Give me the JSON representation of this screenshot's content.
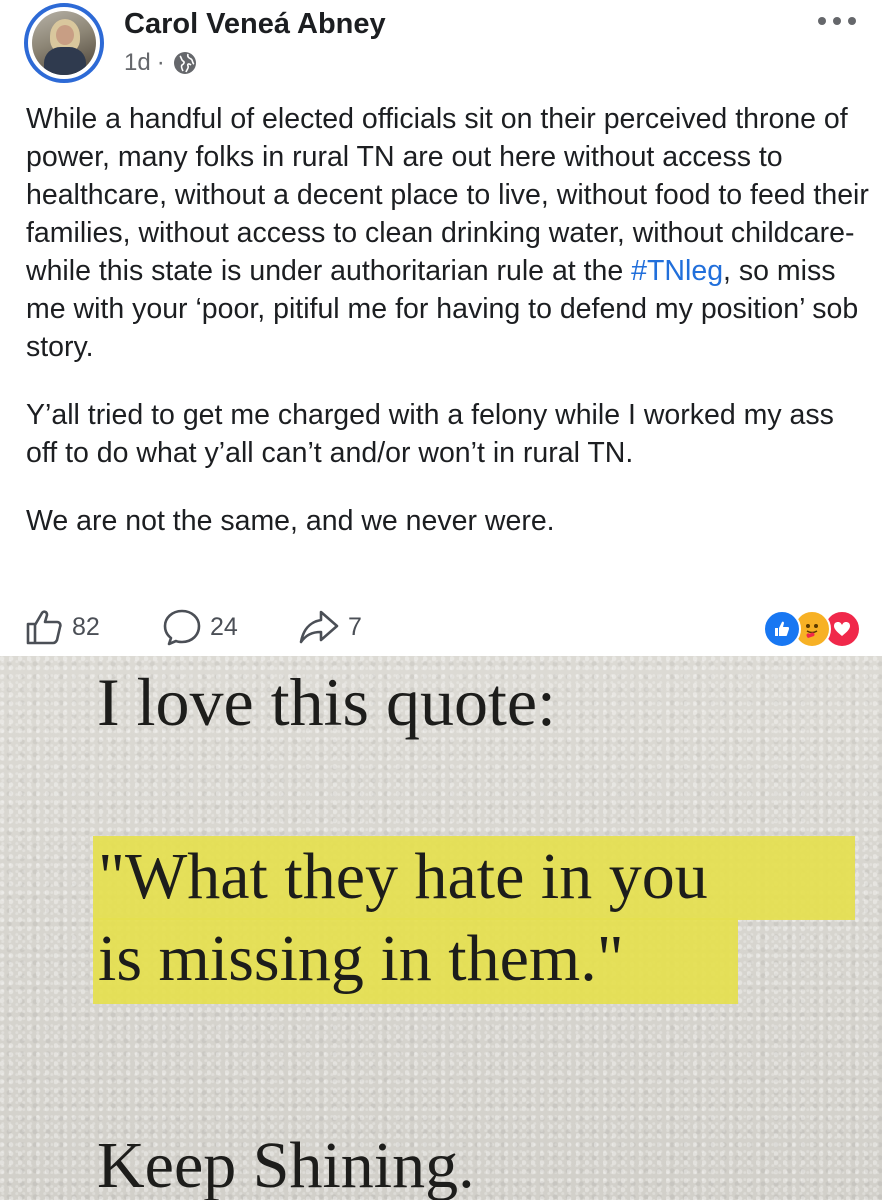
{
  "post": {
    "author": "Carol Veneá Abney",
    "time": "1d",
    "separator": "·",
    "paragraphs": [
      {
        "before": "While a handful of elected officials sit on their perceived throne of power, many folks in rural TN are out here without access to healthcare, without a decent place to live, without food to feed their families, without access to clean drinking water, without childcare- while this state is under authoritarian rule at the ",
        "hashtag": "#TNleg",
        "after": ", so miss me with your ‘poor, pitiful me for having to defend my position’ sob story."
      },
      "Y’all tried to get me charged with a felony while I worked my ass off to do what y’all can’t and/or won’t in rural TN.",
      "We are not the same, and we never were."
    ]
  },
  "actions": {
    "like_count": "82",
    "comment_count": "24",
    "share_count": "7"
  },
  "reactions": [
    "like-icon",
    "care-icon",
    "love-icon"
  ],
  "colors": {
    "link": "#216fdb",
    "avatar_ring": "#2d6ad6",
    "like": "#1877f2",
    "love": "#f0284a",
    "care": "#f7b125",
    "highlight": "#e5e04e"
  },
  "image": {
    "line1": "I love this quote:",
    "line2": "\"What they hate in you",
    "line3": "is missing in them.\"",
    "line4": "Keep Shining."
  }
}
